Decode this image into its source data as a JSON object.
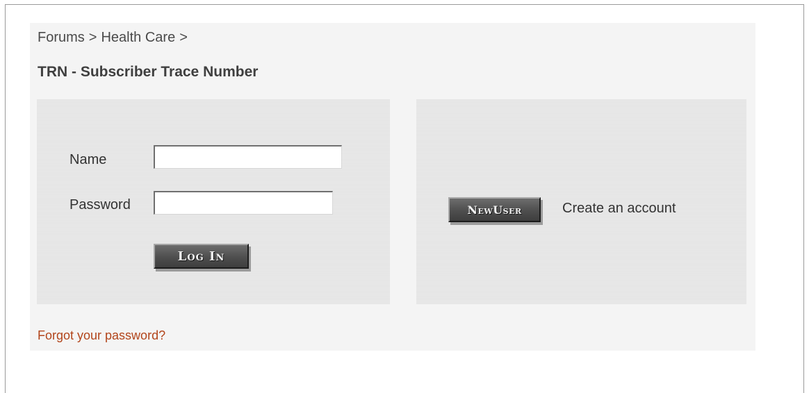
{
  "breadcrumb": {
    "items": [
      "Forums",
      "Health Care"
    ],
    "separator": ">"
  },
  "page": {
    "title": "TRN - Subscriber Trace Number"
  },
  "login": {
    "name_label": "Name",
    "name_value": "",
    "password_label": "Password",
    "password_value": "",
    "login_button": "Log In"
  },
  "new_user": {
    "button_label": "NewUser",
    "create_text": "Create an account"
  },
  "forgot": {
    "link_text": "Forgot your password?"
  },
  "colors": {
    "content_bg": "#f4f4f4",
    "panel_bg": "#e6e6e6",
    "link_color": "#b2451b",
    "button_bg": "#4e4e4e"
  }
}
